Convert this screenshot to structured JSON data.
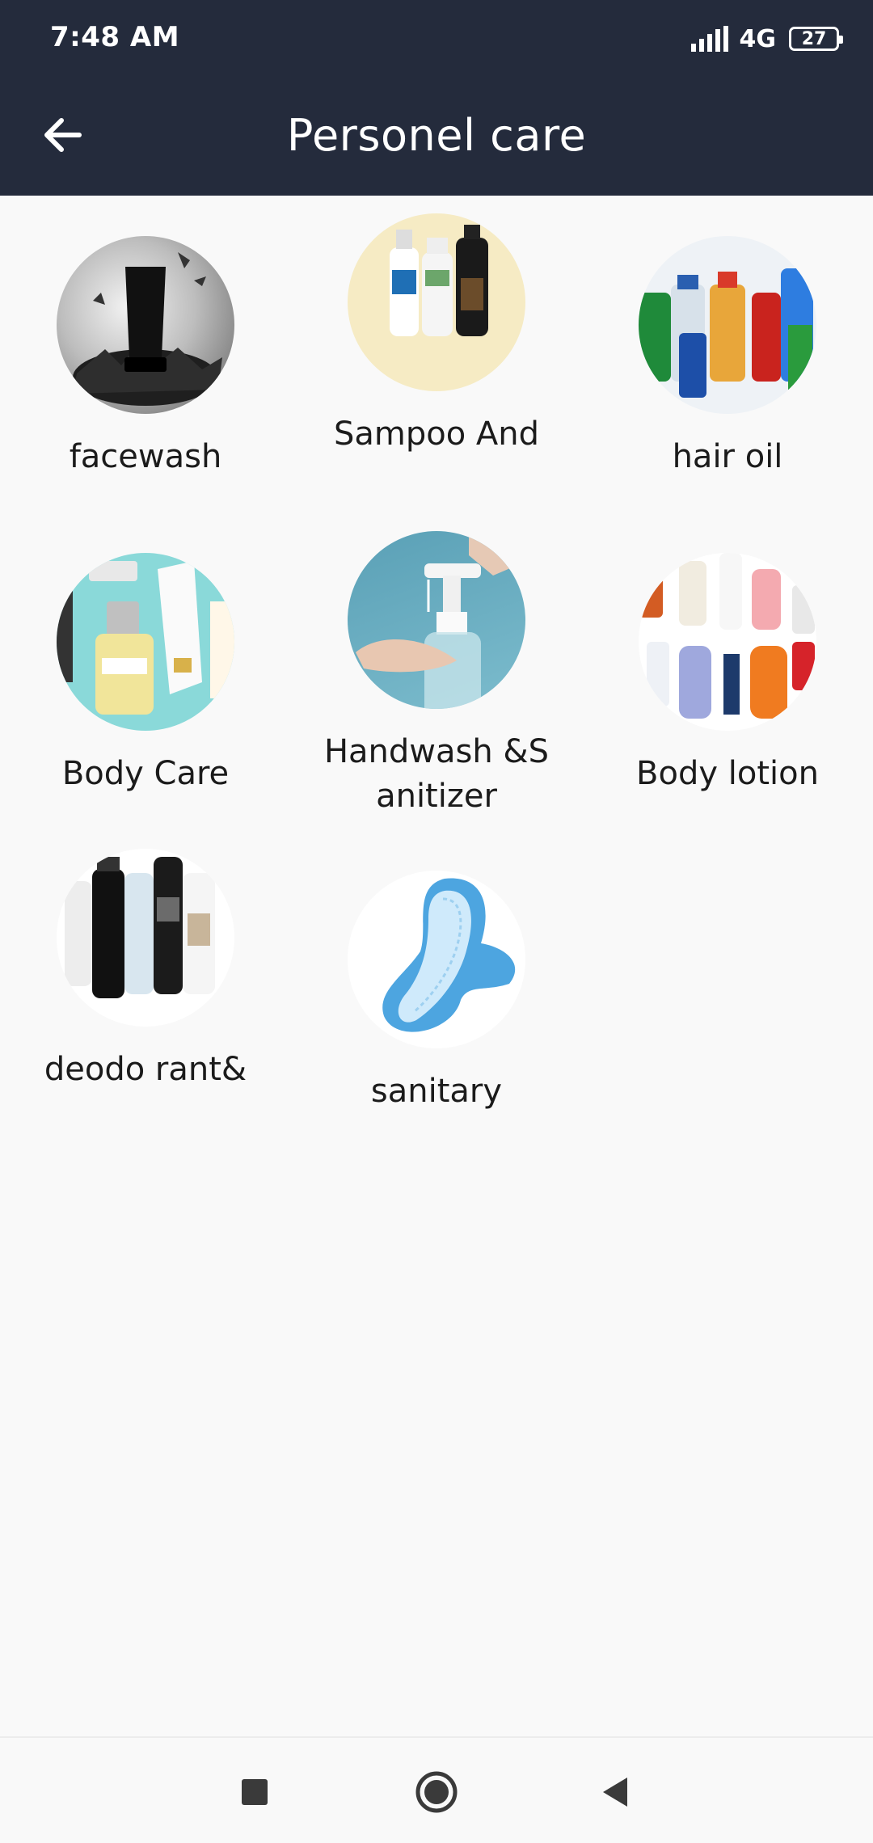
{
  "status_bar": {
    "time": "7:48 AM",
    "network": "4G",
    "battery": "27"
  },
  "app_bar": {
    "title": "Personel care",
    "back_icon": "arrow-left-icon"
  },
  "categories": [
    {
      "label": "facewash"
    },
    {
      "label": "Sampoo And"
    },
    {
      "label": "hair oil"
    },
    {
      "label": "Body Care"
    },
    {
      "label": "Handwash &Sanitizer"
    },
    {
      "label": "Body lotion"
    },
    {
      "label": "deodo rant&"
    },
    {
      "label": "sanitary"
    }
  ],
  "nav_bar": {
    "icons": [
      "recent-apps-icon",
      "home-icon",
      "back-triangle-icon"
    ]
  },
  "colors": {
    "header_bg": "#242b3c",
    "page_bg": "#f9f9f9",
    "text": "#1b1b1b"
  }
}
